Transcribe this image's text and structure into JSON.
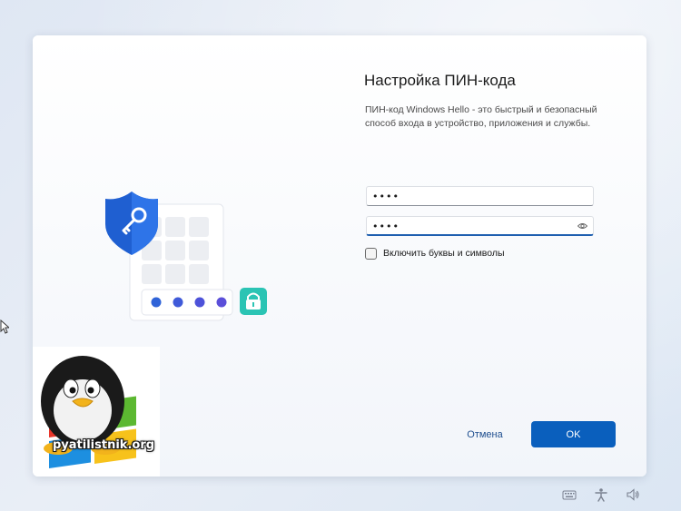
{
  "dialog": {
    "title": "Настройка ПИН-кода",
    "description": "ПИН-код Windows Hello - это быстрый и безопасный способ входа в устройство, приложения и службы.",
    "pin_field": {
      "value": "1234"
    },
    "confirm_field": {
      "value": "1234"
    },
    "checkbox_label": "Включить буквы и символы",
    "cancel_label": "Отмена",
    "ok_label": "OK"
  },
  "watermark": {
    "text": "pyatilistnik.org"
  },
  "icons": {
    "shield": "shield-key-icon",
    "keypad": "keypad-icon",
    "lock": "lock-icon",
    "eye": "eye-icon",
    "keyboard": "keyboard-icon",
    "accessibility": "accessibility-icon",
    "volume": "volume-icon"
  },
  "colors": {
    "accent": "#0a5fbd",
    "shield": "#1f5fd1",
    "lock": "#2bc4b4",
    "dots": "#5b4fd9"
  }
}
